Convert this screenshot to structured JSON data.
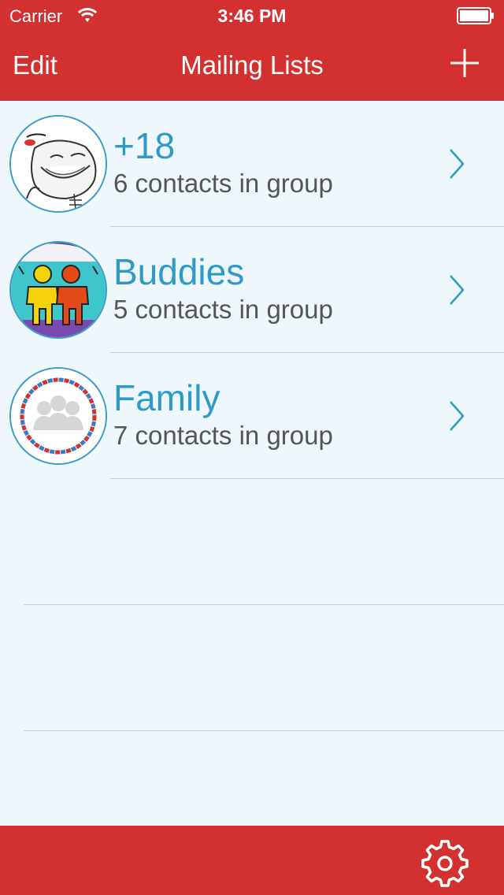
{
  "status_bar": {
    "carrier": "Carrier",
    "time": "3:46 PM"
  },
  "nav": {
    "edit_label": "Edit",
    "title": "Mailing Lists"
  },
  "lists": [
    {
      "title": "+18",
      "subtitle": "6 contacts in group",
      "avatar": "troll-face-image"
    },
    {
      "title": "Buddies",
      "subtitle": "5 contacts in group",
      "avatar": "buddies-image"
    },
    {
      "title": "Family",
      "subtitle": "7 contacts in group",
      "avatar": "airmail-group-image"
    }
  ],
  "icons": {
    "add": "plus-icon",
    "settings": "gear-icon",
    "disclosure": "chevron-right-icon",
    "wifi": "wifi-icon",
    "battery": "battery-icon"
  },
  "colors": {
    "accent": "#d33131",
    "link": "#2f9ac6",
    "background": "#eef7fc"
  }
}
